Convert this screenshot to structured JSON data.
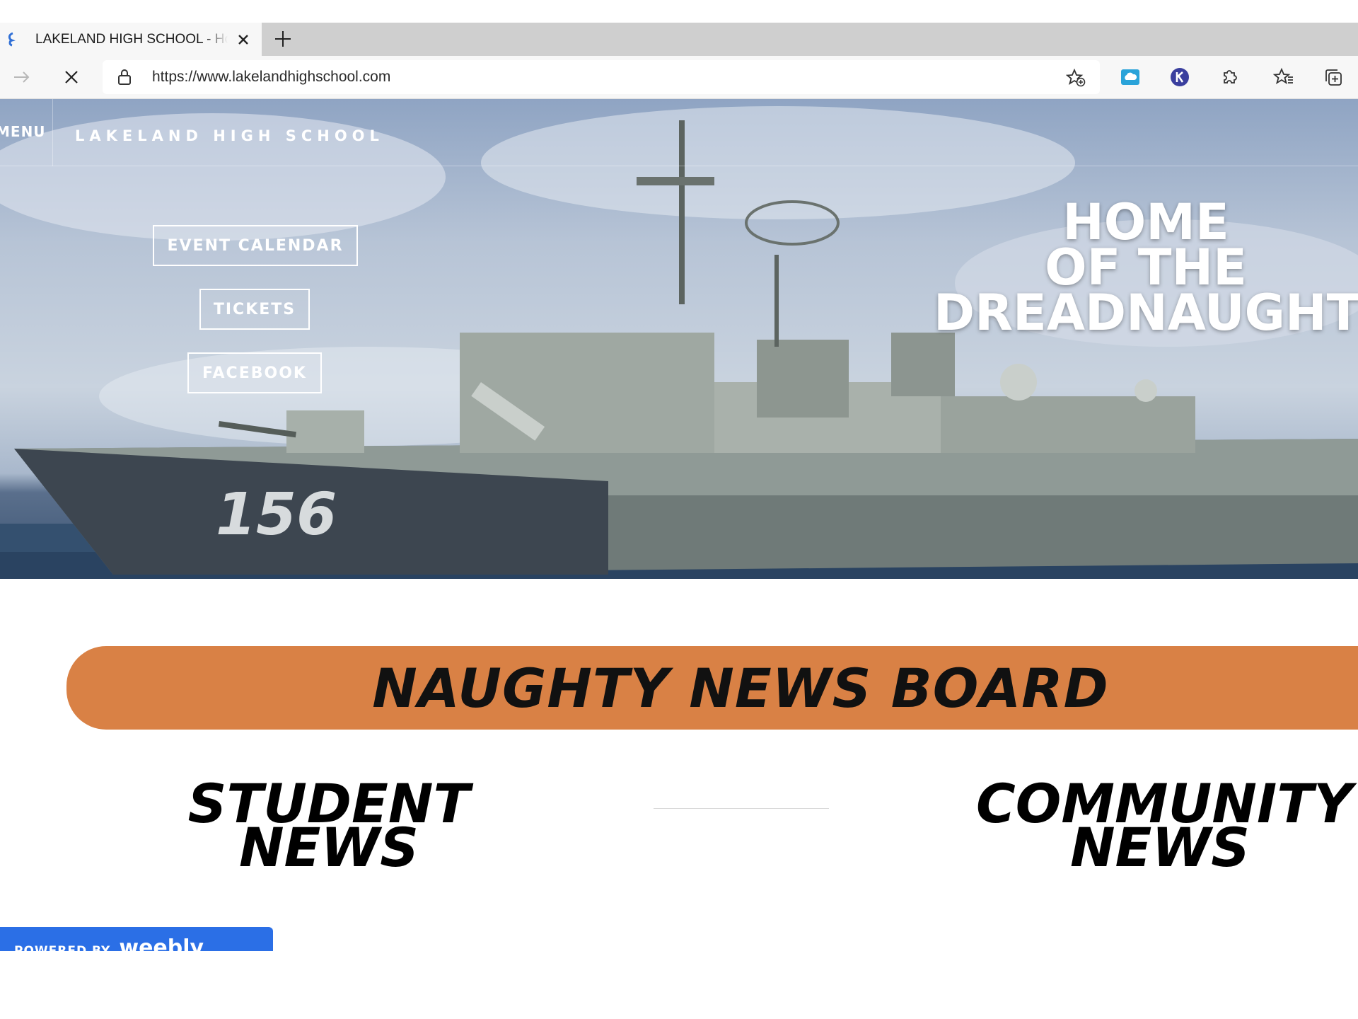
{
  "browser": {
    "tab_title": "LAKELAND HIGH SCHOOL - Home",
    "url": "https://www.lakelandhighschool.com",
    "icons": [
      "favicon-icon",
      "close-icon",
      "plus-icon",
      "forward-icon",
      "stop-icon",
      "lock-icon",
      "add-favorite-icon",
      "extension-cloud-icon",
      "extension-k-icon",
      "extensions-icon",
      "favorites-icon",
      "collections-icon"
    ]
  },
  "site": {
    "menu_label": "MENU",
    "name": "LAKELAND HIGH SCHOOL",
    "buttons": {
      "calendar": "EVENT CALENDAR",
      "tickets": "TICKETS",
      "facebook": "FACEBOOK"
    },
    "headline": {
      "line1": "HOME",
      "line2": "OF THE",
      "line3": "DREADNAUGHTS"
    }
  },
  "news": {
    "banner_title": "NAUGHTY NEWS BOARD",
    "student": {
      "line1": "STUDENT",
      "line2": "NEWS"
    },
    "community": {
      "line1": "COMMUNITY",
      "line2": "NEWS"
    }
  },
  "footer_badge": {
    "prefix": "POWERED BY",
    "brand": "weebly"
  },
  "colors": {
    "banner": "#d98145",
    "badge": "#2b6fe6",
    "tabbar": "#cfcfcf"
  }
}
